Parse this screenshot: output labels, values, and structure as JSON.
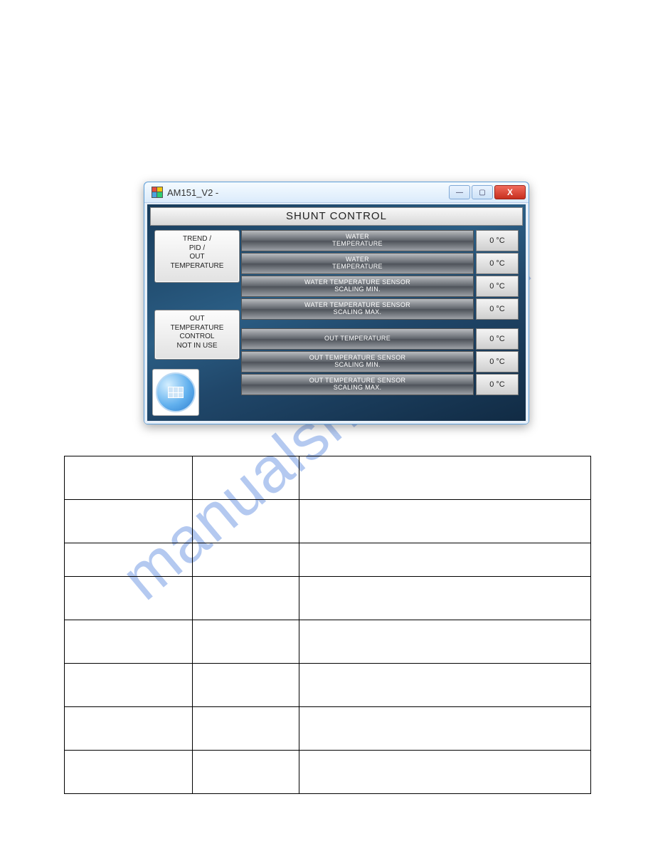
{
  "watermark": "manualshive.com",
  "window": {
    "title": "AM151_V2 -",
    "panel_title": "SHUNT CONTROL",
    "side_buttons": {
      "trend": "TREND /\nPID /\nOUT\nTEMPERATURE",
      "notinuse": "OUT\nTEMPERATURE\nCONTROL\nNOT IN USE"
    },
    "rows": [
      {
        "label": "WATER\nTEMPERATURE",
        "value": "0 °C"
      },
      {
        "label": "WATER\nTEMPERATURE",
        "value": "0 °C"
      },
      {
        "label": "WATER TEMPERATURE SENSOR\nSCALING MIN.",
        "value": "0 °C"
      },
      {
        "label": "WATER TEMPERATURE SENSOR\nSCALING MAX.",
        "value": "0 °C"
      },
      {
        "label": "OUT TEMPERATURE",
        "value": "0 °C"
      },
      {
        "label": "OUT TEMPERATURE SENSOR\nSCALING MIN.",
        "value": "0 °C"
      },
      {
        "label": "OUT TEMPERATURE SENSOR\nSCALING MAX.",
        "value": "0 °C"
      }
    ],
    "caption": {
      "min": "—",
      "max": "▢",
      "close": "X"
    }
  },
  "table": {
    "rows": [
      [
        "",
        "",
        ""
      ],
      [
        "",
        "",
        ""
      ],
      [
        "",
        "",
        ""
      ],
      [
        "",
        "",
        ""
      ],
      [
        "",
        "",
        ""
      ],
      [
        "",
        "",
        ""
      ],
      [
        "",
        "",
        ""
      ],
      [
        "",
        "",
        ""
      ]
    ]
  }
}
